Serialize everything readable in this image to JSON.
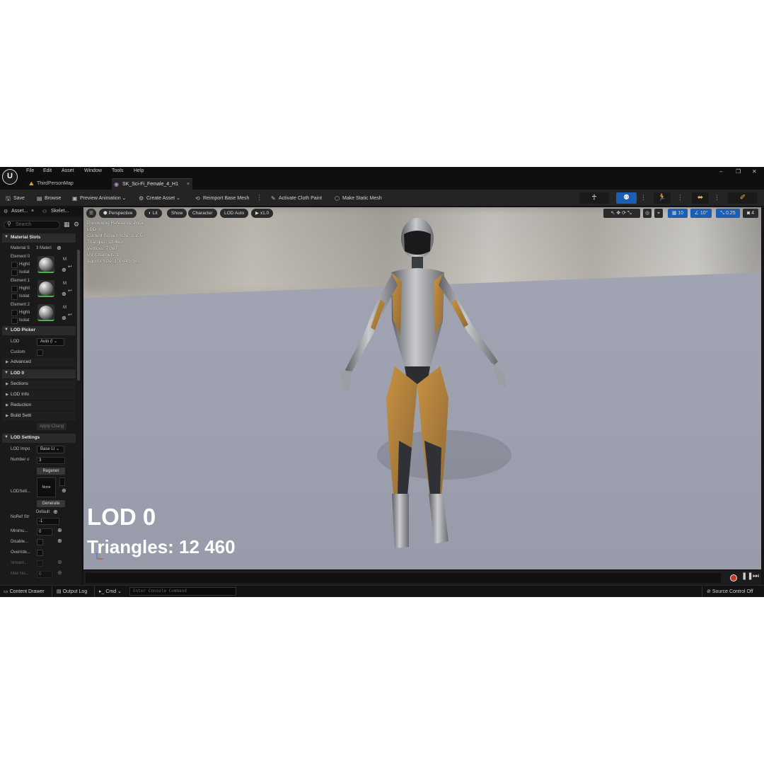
{
  "menu": [
    "File",
    "Edit",
    "Asset",
    "Window",
    "Tools",
    "Help"
  ],
  "window_controls": {
    "minimize": "–",
    "restore": "❐",
    "close": "✕"
  },
  "tabs": [
    {
      "label": "ThirdPersonMap",
      "icon": "level-icon",
      "active": false
    },
    {
      "label": "SK_Sci-Fi_Female_4_H1",
      "icon": "skeletal-mesh-icon",
      "active": true,
      "close": "×"
    }
  ],
  "toolbar": {
    "save": "Save",
    "browse": "Browse",
    "preview_animation": "Preview Animation",
    "create_asset": "Create Asset",
    "reimport": "Reimport Base Mesh",
    "activate_cloth": "Activate Cloth Paint",
    "make_static": "Make Static Mesh",
    "accent_color": "#1b5fb5"
  },
  "panel": {
    "tabs": [
      "Asset...",
      "Skelet..."
    ],
    "search_placeholder": "Search",
    "material_slots": {
      "header": "Material Slots",
      "slots_label": "Material S",
      "slots_value": "3 Materi",
      "elements": [
        {
          "label": "Element 0",
          "highlight": "Highli",
          "isolate": "Isolat",
          "m": "M"
        },
        {
          "label": "Element 1",
          "highlight": "Highli",
          "isolate": "Isolat",
          "m": "M"
        },
        {
          "label": "Element 2",
          "highlight": "Highli",
          "isolate": "Isolat",
          "m": "M"
        }
      ]
    },
    "lod_picker": {
      "header": "LOD Picker",
      "lod_label": "LOD",
      "lod_value": "Auto (l",
      "custom_label": "Custom",
      "advanced": "Advanced"
    },
    "lod0": {
      "header": "LOD 0",
      "items": [
        "Sections",
        "LOD Info",
        "Reduction",
        "Build Setti"
      ],
      "apply": "Apply Chang"
    },
    "lod_settings": {
      "header": "LOD Settings",
      "import_label": "LOD Impo",
      "import_value": "Base LI",
      "number_label": "Number o",
      "number_value": "3",
      "regen": "Regener",
      "lodsett_label": "LODSett...",
      "none": "None",
      "generate": "Generate",
      "default": "Default",
      "noref_label": "NoRef Str",
      "noref_value": "-1",
      "minimum_label": "Minimu...",
      "minimum_value": "0",
      "disable_label": "Disable...",
      "override_label": "Override...",
      "stream_label": "Stream...",
      "maxnu_label": "Max Nu...",
      "maxnu_value": "0"
    }
  },
  "viewport": {
    "pills": [
      "Perspective",
      "Lit",
      "Show",
      "Character",
      "LOD Auto",
      "x1.0"
    ],
    "stats": [
      "Previewing Reference Pose",
      "LOD: 0",
      "Current Screen Size: 1,105",
      "Triangles: 12 460",
      "Vertices: 7 367",
      "UV Channels: 1",
      "Approx Size: 100x40x180"
    ],
    "right_tools": {
      "grid": "10",
      "angle": "10°",
      "scale": "0.25",
      "cam_speed": "4"
    },
    "lod_label": "LOD 0",
    "triangles_label": "Triangles: 12 460"
  },
  "statusbar": {
    "content_drawer": "Content Drawer",
    "output_log": "Output Log",
    "cmd": "Cmd",
    "console_placeholder": "Enter Console Command",
    "source_control": "Source Control Off"
  }
}
